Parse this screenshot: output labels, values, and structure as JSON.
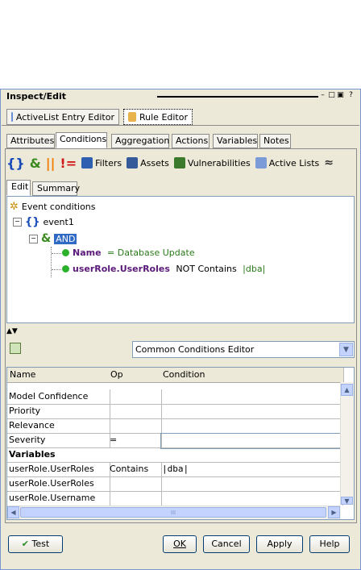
{
  "window": {
    "title": "Inspect/Edit",
    "controls": [
      "–",
      "□",
      "▣",
      "?"
    ]
  },
  "editor_tabs": [
    {
      "label": "ActiveList Entry Editor"
    },
    {
      "label": "Rule Editor"
    }
  ],
  "panel_tabs": [
    "Attributes",
    "Conditions",
    "Aggregation",
    "Actions",
    "Variables",
    "Notes"
  ],
  "toolbar": {
    "filters": "Filters",
    "assets": "Assets",
    "vulnerabilities": "Vulnerabilities",
    "active_lists": "Active Lists",
    "more": "≈"
  },
  "sub_tabs": [
    "Edit",
    "Summary"
  ],
  "tree": {
    "root": "Event conditions",
    "event": "event1",
    "op": "AND",
    "cond1": {
      "field": "Name",
      "rest": " = Database Update"
    },
    "cond2": {
      "field": "userRole.UserRoles",
      "rest": " NOT Contains ",
      "value": "|dba|"
    }
  },
  "conditions_editor": {
    "selected": "Common Conditions Editor"
  },
  "grid": {
    "headers": [
      "Name",
      "Op",
      "Condition"
    ],
    "rows": [
      {
        "name": "Model Confidence",
        "op": "",
        "cond": ""
      },
      {
        "name": "Priority",
        "op": "",
        "cond": ""
      },
      {
        "name": "Relevance",
        "op": "",
        "cond": ""
      },
      {
        "name": "Severity",
        "op": "=",
        "cond": ""
      },
      {
        "name": "Variables",
        "op": "",
        "cond": ""
      },
      {
        "name": "userRole.UserRoles",
        "op": "Contains",
        "cond": "|dba|"
      },
      {
        "name": "userRole.UserRoles",
        "op": "",
        "cond": ""
      },
      {
        "name": "userRole.Username",
        "op": "",
        "cond": ""
      }
    ],
    "hscroll_mark": "III"
  },
  "buttons": {
    "test": "Test",
    "ok": "OK",
    "cancel": "Cancel",
    "apply": "Apply",
    "help": "Help"
  }
}
